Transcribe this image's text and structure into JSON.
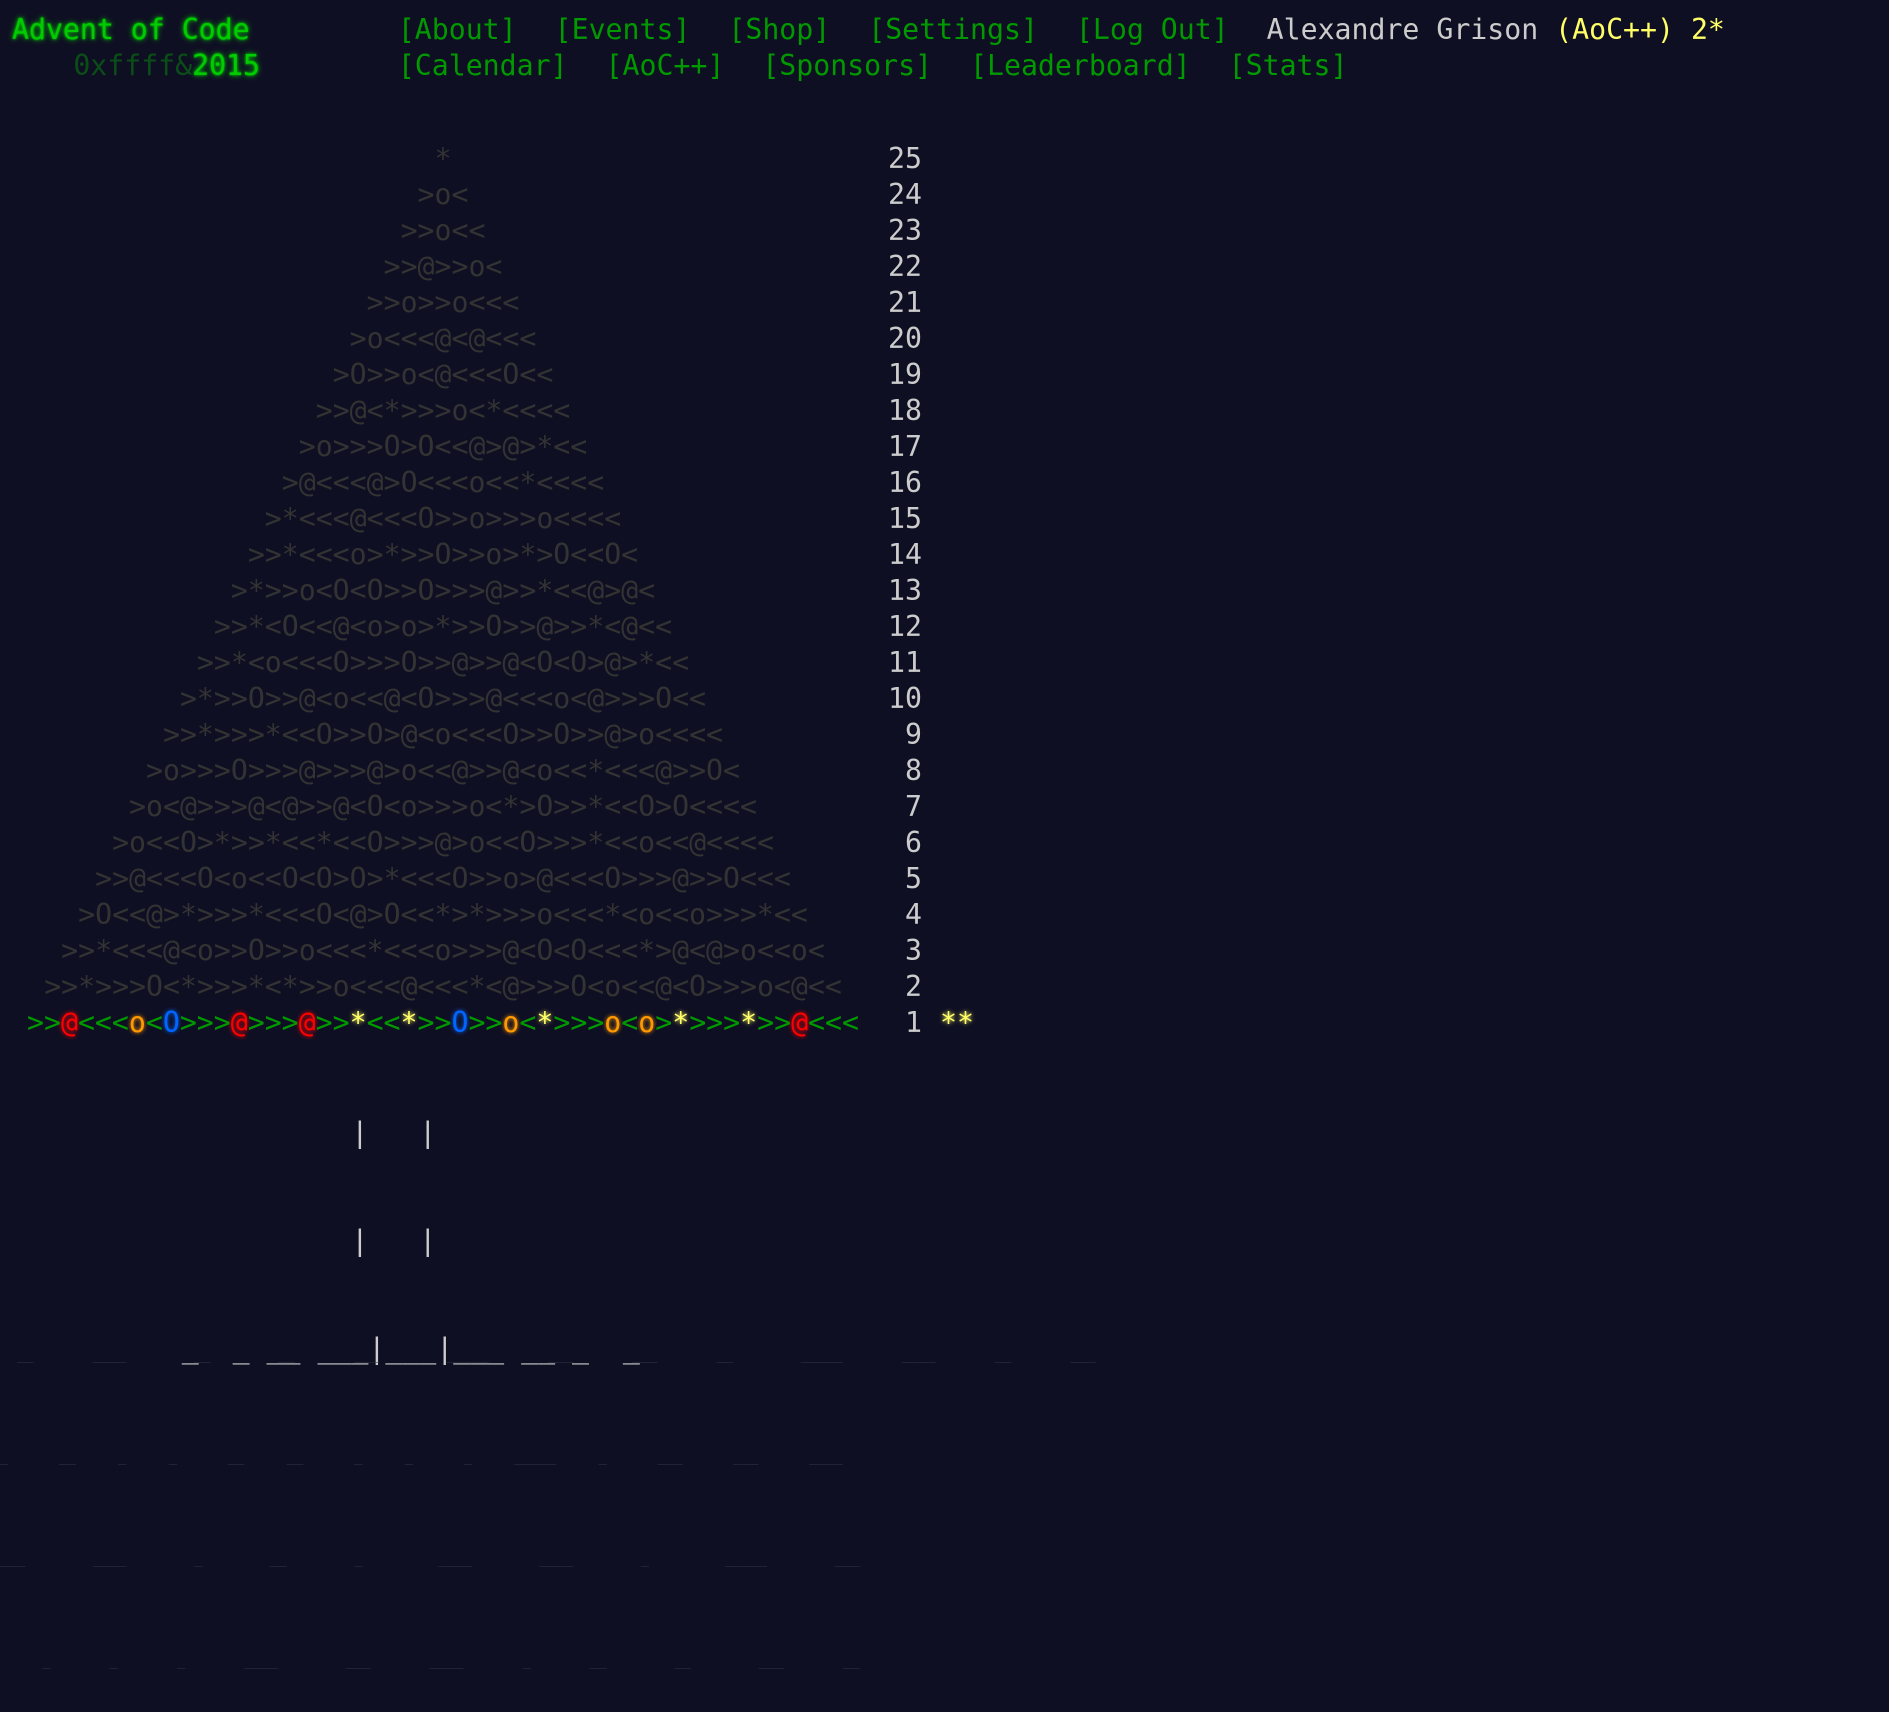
{
  "header": {
    "title": "Advent of Code",
    "year_prefix": "0xffff&",
    "year": "2015",
    "nav_row1": [
      "[About]",
      "[Events]",
      "[Shop]",
      "[Settings]",
      "[Log Out]"
    ],
    "nav_row2": [
      "[Calendar]",
      "[AoC++]",
      "[Sponsors]",
      "[Leaderboard]",
      "[Stats]"
    ],
    "user_name": "Alexandre Grison",
    "supporter": "(AoC++)",
    "total_stars": "2*"
  },
  "calendar": {
    "rows": [
      {
        "art": "*",
        "day": "25",
        "stars": ""
      },
      {
        "art": ">o<",
        "day": "24",
        "stars": ""
      },
      {
        "art": ">>o<<",
        "day": "23",
        "stars": ""
      },
      {
        "art": ">>@>>o<",
        "day": "22",
        "stars": ""
      },
      {
        "art": ">>o>>o<<<",
        "day": "21",
        "stars": ""
      },
      {
        "art": ">o<<<@<@<<<",
        "day": "20",
        "stars": ""
      },
      {
        "art": ">O>>o<@<<<O<<",
        "day": "19",
        "stars": ""
      },
      {
        "art": ">>@<*>>>o<*<<<<",
        "day": "18",
        "stars": ""
      },
      {
        "art": ">o>>>O>O<<@>@>*<<",
        "day": "17",
        "stars": ""
      },
      {
        "art": ">@<<<@>O<<<o<<*<<<<",
        "day": "16",
        "stars": ""
      },
      {
        "art": ">*<<<@<<<O>>o>>>o<<<<",
        "day": "15",
        "stars": ""
      },
      {
        "art": ">>*<<<o>*>>O>>o>*>O<<O<",
        "day": "14",
        "stars": ""
      },
      {
        "art": ">*>>o<O<O>>O>>>@>>*<<@>@<",
        "day": "13",
        "stars": ""
      },
      {
        "art": ">>*<O<<@<o>o>*>>O>>@>>*<@<<",
        "day": "12",
        "stars": ""
      },
      {
        "art": ">>*<o<<<O>>>O>>@>>@<O<O>@>*<<",
        "day": "11",
        "stars": ""
      },
      {
        "art": ">*>>O>>@<o<<@<O>>>@<<<o<@>>>O<<",
        "day": "10",
        "stars": ""
      },
      {
        "art": ">>*>>>*<<O>>O>@<o<<<O>>O>>@>o<<<<",
        "day": "9",
        "stars": ""
      },
      {
        "art": ">o>>>O>>>@>>>@>o<<@>>@<o<<*<<<@>>O<",
        "day": "8",
        "stars": ""
      },
      {
        "art": ">o<@>>>@<@>>@<O<o>>>o<*>O>>*<<O>O<<<<",
        "day": "7",
        "stars": ""
      },
      {
        "art": ">o<<O>*>>*<<*<<O>>>@>o<<O>>>*<<o<<@<<<<",
        "day": "6",
        "stars": ""
      },
      {
        "art": ">>@<<<O<o<<O<O>O>*<<<O>>o>@<<<O>>>@>>O<<<",
        "day": "5",
        "stars": ""
      },
      {
        "art": ">O<<@>*>>>*<<<O<@>O<<*>*>>>o<<<*<o<<o>>>*<<",
        "day": "4",
        "stars": ""
      },
      {
        "art": ">>*<<<@<o>>O>>o<<<*<<<o>>>@<O<O<<<*>@<@>o<<o<",
        "day": "3",
        "stars": ""
      },
      {
        "art": ">>*>>>O<*>>>*<*>>o<<<@<<<*<@>>>O<o<<@<O>>>o<@<<",
        "day": "2",
        "stars": ""
      }
    ],
    "day1": {
      "day": "1",
      "stars": "**",
      "segments": [
        {
          "c": "g",
          "t": ">>"
        },
        {
          "c": "r",
          "t": "@"
        },
        {
          "c": "g",
          "t": "<<<"
        },
        {
          "c": "o",
          "t": "o"
        },
        {
          "c": "g",
          "t": "<"
        },
        {
          "c": "b",
          "t": "O"
        },
        {
          "c": "g",
          "t": ">>>"
        },
        {
          "c": "r",
          "t": "@"
        },
        {
          "c": "g",
          "t": ">>>"
        },
        {
          "c": "r",
          "t": "@"
        },
        {
          "c": "g",
          "t": ">>"
        },
        {
          "c": "y",
          "t": "*"
        },
        {
          "c": "g",
          "t": "<<"
        },
        {
          "c": "y",
          "t": "*"
        },
        {
          "c": "g",
          "t": ">>"
        },
        {
          "c": "b",
          "t": "O"
        },
        {
          "c": "g",
          "t": ">>"
        },
        {
          "c": "o",
          "t": "o"
        },
        {
          "c": "g",
          "t": "<"
        },
        {
          "c": "y",
          "t": "*"
        },
        {
          "c": "g",
          "t": ">>>"
        },
        {
          "c": "o",
          "t": "o"
        },
        {
          "c": "g",
          "t": "<"
        },
        {
          "c": "o",
          "t": "o"
        },
        {
          "c": "g",
          "t": ">"
        },
        {
          "c": "y",
          "t": "*"
        },
        {
          "c": "g",
          "t": ">>>"
        },
        {
          "c": "y",
          "t": "*"
        },
        {
          "c": "g",
          "t": ">>"
        },
        {
          "c": "r",
          "t": "@"
        },
        {
          "c": "g",
          "t": "<<<"
        }
      ]
    },
    "trunk": [
      "                    |   |",
      "                    |   |",
      "          _  _ __ ___|___|___ __ _  _"
    ]
  },
  "snow": [
    "  __       ____        __        __       ___        _____       ___       ___       __        _____       ____       __       ___",
    "_      __     _     _      __     __      _     _      _     _____     _      ___      ___      ____",
    "___        ____        _        __        _         ____        ____        _         _____        ___",
    "     _       _       _       ____        ___       ____       _       __        __        ___       __"
  ]
}
